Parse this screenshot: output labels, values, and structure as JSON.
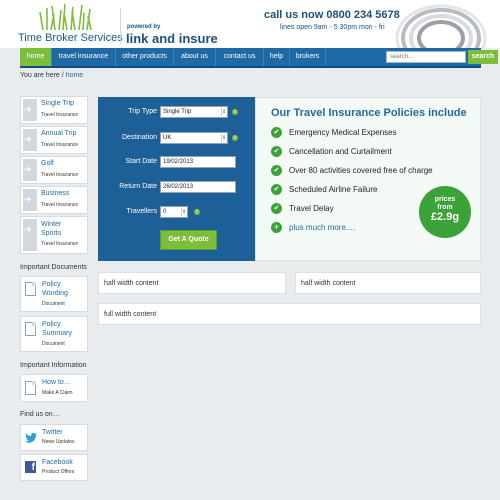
{
  "header": {
    "logo_text": "Time Broker Services",
    "powered_by": "powered by",
    "brand": "link and insure",
    "phone": "call us now 0800 234 5678",
    "hours": "lines open 9am - 5.30pm mon - fri"
  },
  "nav": {
    "items": [
      {
        "label": "home",
        "active": true
      },
      {
        "label": "travel insurance",
        "active": false
      },
      {
        "label": "other products",
        "active": false
      },
      {
        "label": "about us",
        "active": false
      },
      {
        "label": "contact us",
        "active": false
      },
      {
        "label": "help",
        "active": false
      },
      {
        "label": "brokers",
        "active": false
      }
    ],
    "search_placeholder": "search...",
    "search_button": "search"
  },
  "breadcrumb": {
    "prefix": "You are here /",
    "link": "home"
  },
  "sidebar": {
    "products": [
      {
        "title": "Single Trip",
        "subtitle": "Travel Insurance"
      },
      {
        "title": "Annual Trip",
        "subtitle": "Travel Insurance"
      },
      {
        "title": "Golf",
        "subtitle": "Travel Insurance"
      },
      {
        "title": "Business",
        "subtitle": "Travel Insurance"
      },
      {
        "title": "Winter Sports",
        "subtitle": "Travel Insurance"
      }
    ],
    "docs_title": "Important Documents",
    "docs": [
      {
        "title": "Policy Wording",
        "subtitle": "Document"
      },
      {
        "title": "Policy Summary",
        "subtitle": "Document"
      }
    ],
    "info_title": "Important Information",
    "info": [
      {
        "title": "How to…",
        "subtitle": "Make A Claim"
      }
    ],
    "social_title": "Find us on…",
    "social": [
      {
        "title": "Twitter",
        "subtitle": "News Updates"
      },
      {
        "title": "Facebook",
        "subtitle": "Product Offers"
      }
    ]
  },
  "quote_form": {
    "trip_type_label": "Trip Type",
    "trip_type_value": "Single Trip",
    "destination_label": "Destination",
    "destination_value": "UK",
    "start_label": "Start Date",
    "start_value": "19/02/2013",
    "return_label": "Return Date",
    "return_value": "26/02/2013",
    "travellers_label": "Travellers",
    "travellers_value": "0",
    "button": "Get A Quote"
  },
  "policies": {
    "title": "Our Travel Insurance Policies include",
    "items": [
      "Emergency Medical Expenses",
      "Cancellation and Curtailment",
      "Over 80 activities covered free of charge",
      "Scheduled Airline Failure",
      "Travel Delay"
    ],
    "more": "plus much more....",
    "badge_line1": "prices",
    "badge_line2": "from",
    "badge_price": "£2.9g"
  },
  "content": {
    "half1": "half width content",
    "half2": "half width content",
    "full": "full width content"
  },
  "colors": {
    "nav_blue": "#1f6aa4",
    "accent_green": "#7cbd3a",
    "form_blue": "#1d5f97"
  }
}
